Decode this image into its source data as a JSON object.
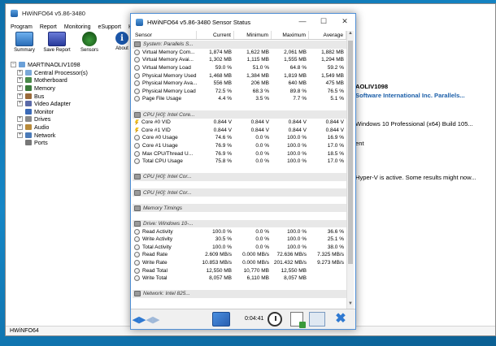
{
  "main_window": {
    "title": "HWiNFO64 v5.86-3480",
    "menu": [
      "Program",
      "Report",
      "Monitoring",
      "eSupport",
      "Help"
    ],
    "toolbar": [
      {
        "label": "Summary",
        "icon": "monitor-icon"
      },
      {
        "label": "Save Report",
        "icon": "save-icon"
      },
      {
        "label": "Sensors",
        "icon": "sensors-icon"
      },
      {
        "label": "About",
        "icon": "info-icon"
      }
    ],
    "tree": {
      "root": "MARTINAOLIV1098",
      "children": [
        "Central Processor(s)",
        "Motherboard",
        "Memory",
        "Bus",
        "Video Adapter",
        "Monitor",
        "Drives",
        "Audio",
        "Network",
        "Ports"
      ]
    },
    "details": {
      "computer_name": "AOLIV1098",
      "vendor": "Software International Inc. Parallels...",
      "os": "Windows 10 Professional (x64) Build 105...",
      "partial": "ent",
      "note": "Hyper-V is active. Some results might now..."
    },
    "status_bar": "HWiNFO64"
  },
  "sensor_window": {
    "title": "HWiNFO64 v5.86-3480 Sensor Status",
    "columns": [
      "Sensor",
      "Current",
      "Minimum",
      "Maximum",
      "Average"
    ],
    "footer_time": "0:04:41",
    "rows": [
      {
        "t": "group",
        "name": "System: Parallels S..."
      },
      {
        "t": "row",
        "name": "Virtual Memory Com...",
        "cur": "1,874 MB",
        "min": "1,622 MB",
        "max": "2,061 MB",
        "avg": "1,882 MB"
      },
      {
        "t": "row",
        "name": "Virtual Memory Avai...",
        "cur": "1,302 MB",
        "min": "1,115 MB",
        "max": "1,555 MB",
        "avg": "1,294 MB"
      },
      {
        "t": "row",
        "name": "Virtual Memory Load",
        "cur": "59.0 %",
        "min": "51.0 %",
        "max": "64.8 %",
        "avg": "59.2 %"
      },
      {
        "t": "row",
        "name": "Physical Memory Used",
        "cur": "1,468 MB",
        "min": "1,384 MB",
        "max": "1,819 MB",
        "avg": "1,549 MB"
      },
      {
        "t": "row",
        "name": "Physical Memory Ava...",
        "cur": "556 MB",
        "min": "206 MB",
        "max": "640 MB",
        "avg": "475 MB"
      },
      {
        "t": "row",
        "name": "Physical Memory Load",
        "cur": "72.5 %",
        "min": "68.3 %",
        "max": "89.8 %",
        "avg": "76.5 %"
      },
      {
        "t": "row",
        "name": "Page File Usage",
        "cur": "4.4 %",
        "min": "3.5 %",
        "max": "7.7 %",
        "avg": "5.1 %"
      },
      {
        "t": "spacer"
      },
      {
        "t": "group",
        "name": "CPU [#0]: Intel Core..."
      },
      {
        "t": "row",
        "v": true,
        "name": "Core #0 VID",
        "cur": "0.844 V",
        "min": "0.844 V",
        "max": "0.844 V",
        "avg": "0.844 V"
      },
      {
        "t": "row",
        "v": true,
        "name": "Core #1 VID",
        "cur": "0.844 V",
        "min": "0.844 V",
        "max": "0.844 V",
        "avg": "0.844 V"
      },
      {
        "t": "row",
        "name": "Core #0 Usage",
        "cur": "74.6 %",
        "min": "0.0 %",
        "max": "100.0 %",
        "avg": "16.9 %"
      },
      {
        "t": "row",
        "name": "Core #1 Usage",
        "cur": "76.9 %",
        "min": "0.0 %",
        "max": "100.0 %",
        "avg": "17.0 %"
      },
      {
        "t": "row",
        "name": "Max CPU/Thread U...",
        "cur": "76.9 %",
        "min": "0.0 %",
        "max": "100.0 %",
        "avg": "18.5 %"
      },
      {
        "t": "row",
        "name": "Total CPU Usage",
        "cur": "75.8 %",
        "min": "0.0 %",
        "max": "100.0 %",
        "avg": "17.0 %"
      },
      {
        "t": "spacer"
      },
      {
        "t": "group",
        "name": "CPU [#0]: Intel Cor..."
      },
      {
        "t": "spacer"
      },
      {
        "t": "group",
        "name": "CPU [#0]: Intel Cor..."
      },
      {
        "t": "spacer"
      },
      {
        "t": "group",
        "name": "Memory Timings"
      },
      {
        "t": "spacer"
      },
      {
        "t": "group",
        "name": "Drive: Windows 10-..."
      },
      {
        "t": "row",
        "name": "Read Activity",
        "cur": "100.0 %",
        "min": "0.0 %",
        "max": "100.0 %",
        "avg": "36.6 %"
      },
      {
        "t": "row",
        "name": "Write Activity",
        "cur": "30.5 %",
        "min": "0.0 %",
        "max": "100.0 %",
        "avg": "25.1 %"
      },
      {
        "t": "row",
        "name": "Total Activity",
        "cur": "100.0 %",
        "min": "0.0 %",
        "max": "100.0 %",
        "avg": "38.0 %"
      },
      {
        "t": "row",
        "name": "Read Rate",
        "cur": "2.609 MB/s",
        "min": "0.000 MB/s",
        "max": "72.636 MB/s",
        "avg": "7.325 MB/s"
      },
      {
        "t": "row",
        "name": "Write Rate",
        "cur": "10.853 MB/s",
        "min": "0.000 MB/s",
        "max": "201.432 MB/s",
        "avg": "9.273 MB/s"
      },
      {
        "t": "row",
        "name": "Read Total",
        "cur": "12,550 MB",
        "min": "10,770 MB",
        "max": "12,550 MB",
        "avg": ""
      },
      {
        "t": "row",
        "name": "Write Total",
        "cur": "8,057 MB",
        "min": "6,110 MB",
        "max": "8,057 MB",
        "avg": ""
      },
      {
        "t": "spacer"
      },
      {
        "t": "group",
        "name": "Network: Intel 825..."
      }
    ]
  },
  "colors": {
    "accent": "#2f79d1",
    "desktop": "#1586c6",
    "vendor_text": "#1a5ea8"
  }
}
